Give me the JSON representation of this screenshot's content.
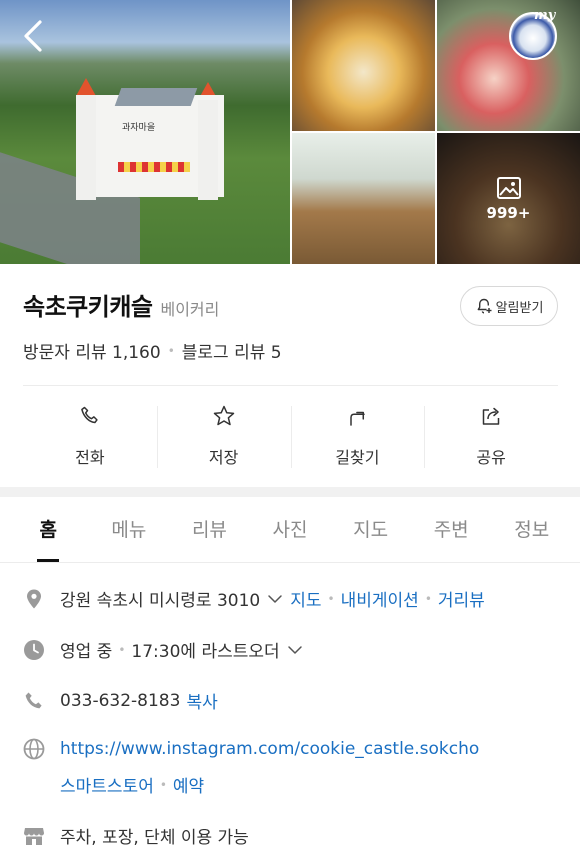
{
  "header": {
    "my_label": "my",
    "photo_count": "999+",
    "sign_text": "과자마을"
  },
  "place": {
    "name": "속초쿠키캐슬",
    "category": "베이커리",
    "alarm_label": "알림받기",
    "visitor_reviews": "방문자 리뷰 1,160",
    "blog_reviews": "블로그 리뷰 5"
  },
  "actions": [
    {
      "label": "전화",
      "icon": "phone-icon"
    },
    {
      "label": "저장",
      "icon": "star-icon"
    },
    {
      "label": "길찾기",
      "icon": "directions-icon"
    },
    {
      "label": "공유",
      "icon": "share-icon"
    }
  ],
  "tabs": [
    {
      "label": "홈",
      "active": true
    },
    {
      "label": "메뉴"
    },
    {
      "label": "리뷰"
    },
    {
      "label": "사진"
    },
    {
      "label": "지도"
    },
    {
      "label": "주변"
    },
    {
      "label": "정보"
    }
  ],
  "info": {
    "address": "강원 속초시 미시령로 3010",
    "map_link": "지도",
    "navi_link": "내비게이션",
    "street_link": "거리뷰",
    "hours_status": "영업 중",
    "hours_detail": "17:30에 라스트오더",
    "phone": "033-632-8183",
    "copy_label": "복사",
    "website": "https://www.instagram.com/cookie_castle.sokcho",
    "smartstore": "스마트스토어",
    "reserve": "예약",
    "amenities": "주차, 포장, 단체 이용 가능"
  },
  "colors": {
    "link": "#1a6fc2",
    "icon_gray": "#9a9a9a",
    "text": "#333333"
  }
}
